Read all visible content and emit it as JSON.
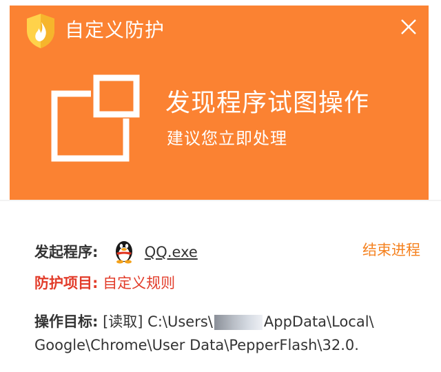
{
  "window": {
    "title": "自定义防护",
    "close_icon": "close-icon",
    "app_icon": "shield-flame-icon",
    "header_color": "#fb8232"
  },
  "alert": {
    "icon": "window-popup-icon",
    "headline": "发现程序试图操作",
    "subline": "建议您立即处理"
  },
  "details": {
    "source_label": "发起程序:",
    "source_icon": "qq-penguin-icon",
    "source_value": "QQ.exe",
    "end_process_label": "结束进程",
    "protect_label": "防护项目:",
    "protect_value": "自定义规则",
    "target_label": "操作目标:",
    "target_op": "[读取]",
    "target_path_part1": "C:\\Users\\",
    "target_path_part2": "AppData\\Local\\",
    "target_path_line2": "Google\\Chrome\\User Data\\PepperFlash\\32.0."
  },
  "colors": {
    "accent_orange": "#fb8232",
    "link_orange": "#f58220",
    "warn_red": "#e23c2a"
  }
}
